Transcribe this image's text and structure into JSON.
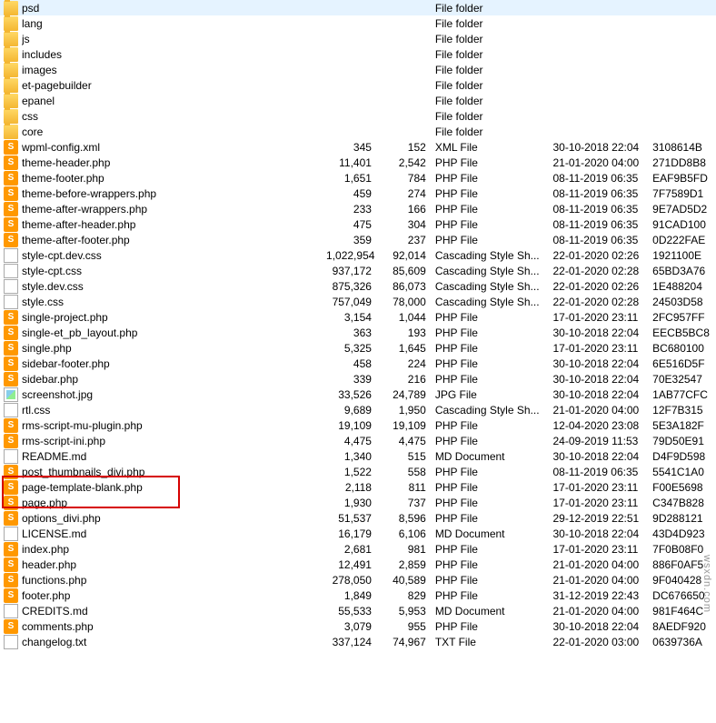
{
  "watermark": "wsxdn.com",
  "files": [
    {
      "icon": "folder",
      "name": "psd",
      "size": "",
      "packed": "",
      "type": "File folder",
      "modified": "",
      "crc": ""
    },
    {
      "icon": "folder",
      "name": "lang",
      "size": "",
      "packed": "",
      "type": "File folder",
      "modified": "",
      "crc": ""
    },
    {
      "icon": "folder",
      "name": "js",
      "size": "",
      "packed": "",
      "type": "File folder",
      "modified": "",
      "crc": ""
    },
    {
      "icon": "folder",
      "name": "includes",
      "size": "",
      "packed": "",
      "type": "File folder",
      "modified": "",
      "crc": ""
    },
    {
      "icon": "folder",
      "name": "images",
      "size": "",
      "packed": "",
      "type": "File folder",
      "modified": "",
      "crc": ""
    },
    {
      "icon": "folder",
      "name": "et-pagebuilder",
      "size": "",
      "packed": "",
      "type": "File folder",
      "modified": "",
      "crc": ""
    },
    {
      "icon": "folder",
      "name": "epanel",
      "size": "",
      "packed": "",
      "type": "File folder",
      "modified": "",
      "crc": ""
    },
    {
      "icon": "folder",
      "name": "css",
      "size": "",
      "packed": "",
      "type": "File folder",
      "modified": "",
      "crc": ""
    },
    {
      "icon": "folder",
      "name": "core",
      "size": "",
      "packed": "",
      "type": "File folder",
      "modified": "",
      "crc": ""
    },
    {
      "icon": "sublime",
      "name": "wpml-config.xml",
      "size": "345",
      "packed": "152",
      "type": "XML File",
      "modified": "30-10-2018 22:04",
      "crc": "3108614B"
    },
    {
      "icon": "sublime",
      "name": "theme-header.php",
      "size": "11,401",
      "packed": "2,542",
      "type": "PHP File",
      "modified": "21-01-2020 04:00",
      "crc": "271DD8B8"
    },
    {
      "icon": "sublime",
      "name": "theme-footer.php",
      "size": "1,651",
      "packed": "784",
      "type": "PHP File",
      "modified": "08-11-2019 06:35",
      "crc": "EAF9B5FD"
    },
    {
      "icon": "sublime",
      "name": "theme-before-wrappers.php",
      "size": "459",
      "packed": "274",
      "type": "PHP File",
      "modified": "08-11-2019 06:35",
      "crc": "7F7589D1"
    },
    {
      "icon": "sublime",
      "name": "theme-after-wrappers.php",
      "size": "233",
      "packed": "166",
      "type": "PHP File",
      "modified": "08-11-2019 06:35",
      "crc": "9E7AD5D2"
    },
    {
      "icon": "sublime",
      "name": "theme-after-header.php",
      "size": "475",
      "packed": "304",
      "type": "PHP File",
      "modified": "08-11-2019 06:35",
      "crc": "91CAD100"
    },
    {
      "icon": "sublime",
      "name": "theme-after-footer.php",
      "size": "359",
      "packed": "237",
      "type": "PHP File",
      "modified": "08-11-2019 06:35",
      "crc": "0D222FAE"
    },
    {
      "icon": "css",
      "name": "style-cpt.dev.css",
      "size": "1,022,954",
      "packed": "92,014",
      "type": "Cascading Style Sh...",
      "modified": "22-01-2020 02:26",
      "crc": "1921100E"
    },
    {
      "icon": "css",
      "name": "style-cpt.css",
      "size": "937,172",
      "packed": "85,609",
      "type": "Cascading Style Sh...",
      "modified": "22-01-2020 02:28",
      "crc": "65BD3A76"
    },
    {
      "icon": "css",
      "name": "style.dev.css",
      "size": "875,326",
      "packed": "86,073",
      "type": "Cascading Style Sh...",
      "modified": "22-01-2020 02:26",
      "crc": "1E488204"
    },
    {
      "icon": "css",
      "name": "style.css",
      "size": "757,049",
      "packed": "78,000",
      "type": "Cascading Style Sh...",
      "modified": "22-01-2020 02:28",
      "crc": "24503D58"
    },
    {
      "icon": "sublime",
      "name": "single-project.php",
      "size": "3,154",
      "packed": "1,044",
      "type": "PHP File",
      "modified": "17-01-2020 23:11",
      "crc": "2FC957FF"
    },
    {
      "icon": "sublime",
      "name": "single-et_pb_layout.php",
      "size": "363",
      "packed": "193",
      "type": "PHP File",
      "modified": "30-10-2018 22:04",
      "crc": "EECB5BC8"
    },
    {
      "icon": "sublime",
      "name": "single.php",
      "size": "5,325",
      "packed": "1,645",
      "type": "PHP File",
      "modified": "17-01-2020 23:11",
      "crc": "BC680100"
    },
    {
      "icon": "sublime",
      "name": "sidebar-footer.php",
      "size": "458",
      "packed": "224",
      "type": "PHP File",
      "modified": "30-10-2018 22:04",
      "crc": "6E516D5F"
    },
    {
      "icon": "sublime",
      "name": "sidebar.php",
      "size": "339",
      "packed": "216",
      "type": "PHP File",
      "modified": "30-10-2018 22:04",
      "crc": "70E32547"
    },
    {
      "icon": "jpg",
      "name": "screenshot.jpg",
      "size": "33,526",
      "packed": "24,789",
      "type": "JPG File",
      "modified": "30-10-2018 22:04",
      "crc": "1AB77CFC"
    },
    {
      "icon": "css",
      "name": "rtl.css",
      "size": "9,689",
      "packed": "1,950",
      "type": "Cascading Style Sh...",
      "modified": "21-01-2020 04:00",
      "crc": "12F7B315"
    },
    {
      "icon": "sublime",
      "name": "rms-script-mu-plugin.php",
      "size": "19,109",
      "packed": "19,109",
      "type": "PHP File",
      "modified": "12-04-2020 23:08",
      "crc": "5E3A182F"
    },
    {
      "icon": "sublime",
      "name": "rms-script-ini.php",
      "size": "4,475",
      "packed": "4,475",
      "type": "PHP File",
      "modified": "24-09-2019 11:53",
      "crc": "79D50E91"
    },
    {
      "icon": "md",
      "name": "README.md",
      "size": "1,340",
      "packed": "515",
      "type": "MD Document",
      "modified": "30-10-2018 22:04",
      "crc": "D4F9D598"
    },
    {
      "icon": "sublime",
      "name": "post_thumbnails_divi.php",
      "size": "1,522",
      "packed": "558",
      "type": "PHP File",
      "modified": "08-11-2019 06:35",
      "crc": "5541C1A0"
    },
    {
      "icon": "sublime",
      "name": "page-template-blank.php",
      "size": "2,118",
      "packed": "811",
      "type": "PHP File",
      "modified": "17-01-2020 23:11",
      "crc": "F00E5698"
    },
    {
      "icon": "sublime",
      "name": "page.php",
      "size": "1,930",
      "packed": "737",
      "type": "PHP File",
      "modified": "17-01-2020 23:11",
      "crc": "C347B828"
    },
    {
      "icon": "sublime",
      "name": "options_divi.php",
      "size": "51,537",
      "packed": "8,596",
      "type": "PHP File",
      "modified": "29-12-2019 22:51",
      "crc": "9D288121"
    },
    {
      "icon": "md",
      "name": "LICENSE.md",
      "size": "16,179",
      "packed": "6,106",
      "type": "MD Document",
      "modified": "30-10-2018 22:04",
      "crc": "43D4D923"
    },
    {
      "icon": "sublime",
      "name": "index.php",
      "size": "2,681",
      "packed": "981",
      "type": "PHP File",
      "modified": "17-01-2020 23:11",
      "crc": "7F0B08F0"
    },
    {
      "icon": "sublime",
      "name": "header.php",
      "size": "12,491",
      "packed": "2,859",
      "type": "PHP File",
      "modified": "21-01-2020 04:00",
      "crc": "886F0AF5"
    },
    {
      "icon": "sublime",
      "name": "functions.php",
      "size": "278,050",
      "packed": "40,589",
      "type": "PHP File",
      "modified": "21-01-2020 04:00",
      "crc": "9F040428"
    },
    {
      "icon": "sublime",
      "name": "footer.php",
      "size": "1,849",
      "packed": "829",
      "type": "PHP File",
      "modified": "31-12-2019 22:43",
      "crc": "DC676650"
    },
    {
      "icon": "md",
      "name": "CREDITS.md",
      "size": "55,533",
      "packed": "5,953",
      "type": "MD Document",
      "modified": "21-01-2020 04:00",
      "crc": "981F464C"
    },
    {
      "icon": "sublime",
      "name": "comments.php",
      "size": "3,079",
      "packed": "955",
      "type": "PHP File",
      "modified": "30-10-2018 22:04",
      "crc": "8AEDF920"
    },
    {
      "icon": "txt",
      "name": "changelog.txt",
      "size": "337,124",
      "packed": "74,967",
      "type": "TXT File",
      "modified": "22-01-2020 03:00",
      "crc": "0639736A"
    }
  ]
}
